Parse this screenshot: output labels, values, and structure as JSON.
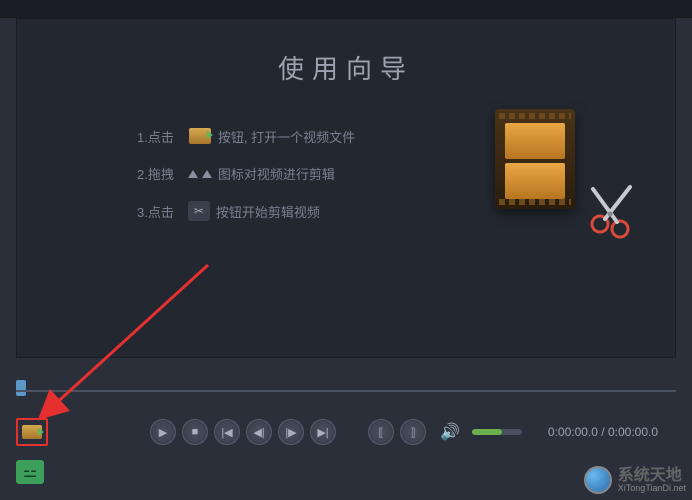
{
  "title": "使用向导",
  "steps": {
    "s1_prefix": "1.点击",
    "s1_suffix": "按钮, 打开一个视频文件",
    "s2_prefix": "2.拖拽",
    "s2_suffix": "图标对视频进行剪辑",
    "s3_prefix": "3.点击",
    "s3_suffix": "按钮开始剪辑视频"
  },
  "playback": {
    "time_current": "0:00:00.0",
    "time_total": "0:00:00.0",
    "time_sep": " / "
  },
  "icons": {
    "play": "▶",
    "stop": "■",
    "prev": "|◀",
    "prev_frame": "◀|",
    "next_frame": "|▶",
    "next": "▶|",
    "mark_in": "⟦",
    "mark_out": "⟧",
    "volume": "🔊",
    "expand": "⚍"
  },
  "watermark": {
    "name": "系统天地",
    "url": "XiTongTianDi.net"
  }
}
